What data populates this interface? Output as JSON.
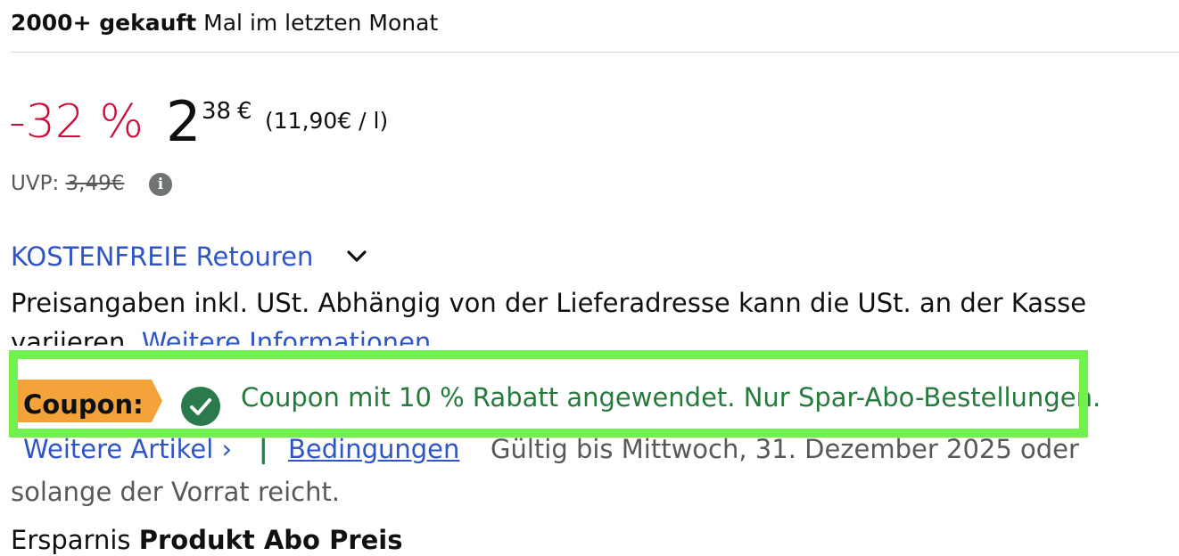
{
  "social_proof": {
    "bold": "2000+ gekauft",
    "rest": "Mal im letzten Monat"
  },
  "price": {
    "discount": "-32 %",
    "whole": "2",
    "fraction": "38",
    "currency": "€",
    "unit_price": "(11,90€ / l)"
  },
  "uvp": {
    "label": "UVP:",
    "value": "3,49€"
  },
  "returns": {
    "label": "KOSTENFREIE Retouren"
  },
  "tax": {
    "line1": "Preisangaben inkl. USt. Abhängig von der Lieferadresse kann die USt. an der Kasse",
    "line2_text": "variieren.",
    "line2_link": "Weitere Informationen"
  },
  "coupon": {
    "label": "Coupon:",
    "applied_text": "Coupon mit 10 % Rabatt angewendet. Nur Spar-Abo-Bestellungen.",
    "more_items": "Weitere Artikel ›",
    "separator": "|",
    "terms": "Bedingungen",
    "validity_line1": "Gültig bis Mittwoch, 31. Dezember 2025 oder",
    "validity_line2": "solange der Vorrat reicht."
  },
  "cutoff_text": {
    "normal": "Ersparnis",
    "bold": "Produkt Abo Preis"
  },
  "colors": {
    "discount": "#cc0c39",
    "link": "#2f55c5",
    "coupon_green": "#267a3d",
    "coupon_tag": "#f3a33a",
    "highlight": "#72f04e"
  }
}
